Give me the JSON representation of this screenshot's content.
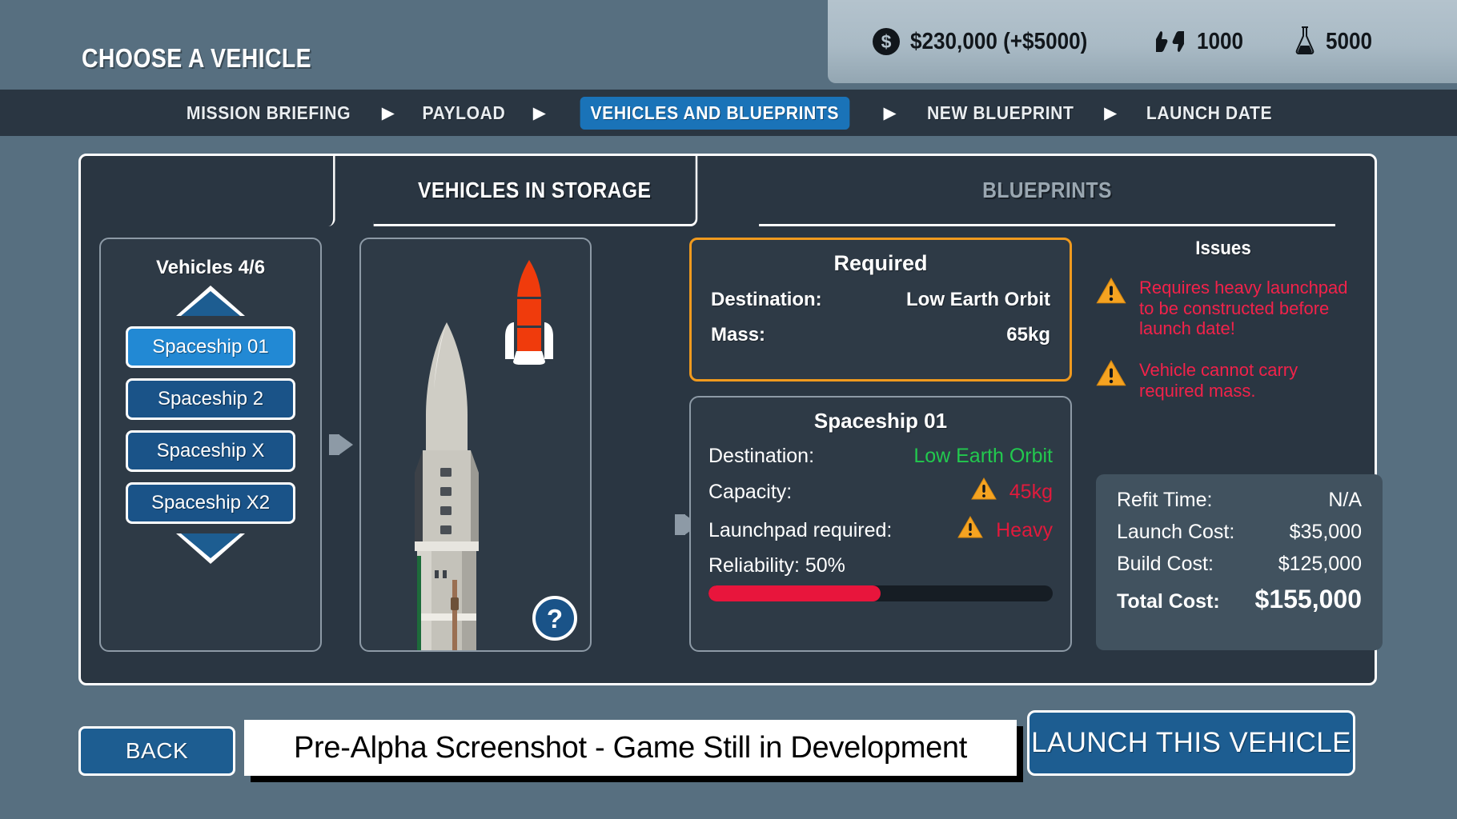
{
  "header": {
    "title": "CHOOSE A VEHICLE",
    "resources": [
      {
        "icon": "coin-icon",
        "name": "money",
        "value": "$230,000 (+$5000)"
      },
      {
        "icon": "reputation-icon",
        "name": "reputation",
        "value": "1000"
      },
      {
        "icon": "science-flask-icon",
        "name": "science",
        "value": "5000"
      }
    ]
  },
  "breadcrumb": {
    "separator": "▶",
    "steps": [
      {
        "label": "MISSION BRIEFING",
        "active": false
      },
      {
        "label": "PAYLOAD",
        "active": false
      },
      {
        "label": "VEHICLES AND BLUEPRINTS",
        "active": true
      },
      {
        "label": "NEW BLUEPRINT",
        "active": false
      },
      {
        "label": "LAUNCH DATE",
        "active": false
      }
    ]
  },
  "tabs": {
    "active_label": "VEHICLES IN STORAGE",
    "inactive_label": "BLUEPRINTS"
  },
  "vehicle_list": {
    "title": "Vehicles 4/6",
    "scroll_up_icon": "triangle-up-icon",
    "scroll_down_icon": "triangle-down-icon",
    "items": [
      {
        "label": "Spaceship 01",
        "selected": true
      },
      {
        "label": "Spaceship 2",
        "selected": false
      },
      {
        "label": "Spaceship X",
        "selected": false
      },
      {
        "label": "Spaceship X2",
        "selected": false
      }
    ]
  },
  "preview": {
    "help_label": "?",
    "rocket_icon": "rocket-icon"
  },
  "required": {
    "title": "Required",
    "rows": [
      {
        "label": "Destination:",
        "value": "Low Earth Orbit"
      },
      {
        "label": "Mass:",
        "value": "65kg"
      }
    ]
  },
  "detail": {
    "title": "Spaceship 01",
    "destination_label": "Destination:",
    "destination_value": "Low Earth Orbit",
    "capacity_label": "Capacity:",
    "capacity_value": "45kg",
    "launchpad_label": "Launchpad required:",
    "launchpad_value": "Heavy",
    "reliability_label": "Reliability: 50%",
    "reliability_percent": 50,
    "warning_icon": "warning-triangle-icon"
  },
  "issues": {
    "title": "Issues",
    "items": [
      {
        "icon": "warning-triangle-icon",
        "text": "Requires heavy launchpad to be constructed before launch date!"
      },
      {
        "icon": "warning-triangle-icon",
        "text": "Vehicle cannot carry required mass."
      }
    ]
  },
  "costs": {
    "rows": [
      {
        "label": "Refit Time:",
        "value": "N/A"
      },
      {
        "label": "Launch Cost:",
        "value": "$35,000"
      },
      {
        "label": "Build Cost:",
        "value": "$125,000"
      }
    ],
    "total_label": "Total Cost:",
    "total_value": "$155,000"
  },
  "footer": {
    "back_label": "BACK",
    "watermark": "Pre-Alpha Screenshot - Game Still in Development",
    "launch_label": "LAUNCH THIS VEHICLE"
  },
  "colors": {
    "background": "#576f80",
    "panel": "#2a3642",
    "accent_blue": "#1d5d91",
    "selected_blue": "#2289d4",
    "warning_orange": "#f09a1e",
    "error_red": "#f2224a",
    "ok_green": "#22c94e"
  }
}
